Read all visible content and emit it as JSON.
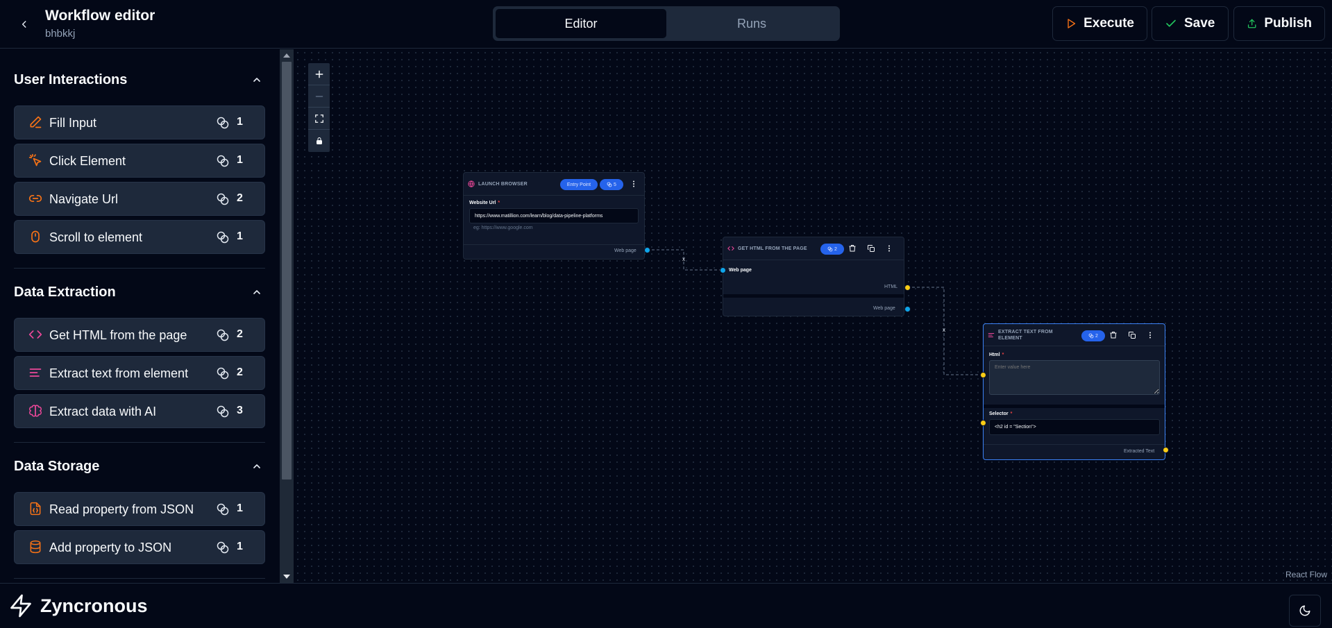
{
  "header": {
    "title": "Workflow editor",
    "subtitle": "bhbkkj",
    "tabs": [
      {
        "label": "Editor",
        "active": true
      },
      {
        "label": "Runs",
        "active": false
      }
    ],
    "buttons": {
      "execute": "Execute",
      "save": "Save",
      "publish": "Publish"
    },
    "colors": {
      "execute_icon": "#f97316",
      "save_icon": "#22c55e",
      "publish_icon": "#22c55e"
    }
  },
  "sidebar": {
    "sections": [
      {
        "title": "User Interactions",
        "items": [
          {
            "label": "Fill Input",
            "credits": "1",
            "icon": "pencil-icon"
          },
          {
            "label": "Click Element",
            "credits": "1",
            "icon": "pointer-click-icon"
          },
          {
            "label": "Navigate Url",
            "credits": "2",
            "icon": "link-icon"
          },
          {
            "label": "Scroll to element",
            "credits": "1",
            "icon": "mouse-icon"
          }
        ]
      },
      {
        "title": "Data Extraction",
        "items": [
          {
            "label": "Get HTML from the page",
            "credits": "2",
            "icon": "code-icon"
          },
          {
            "label": "Extract text from element",
            "credits": "2",
            "icon": "text-lines-icon"
          },
          {
            "label": "Extract data with AI",
            "credits": "3",
            "icon": "brain-icon"
          }
        ]
      },
      {
        "title": "Data Storage",
        "items": [
          {
            "label": "Read property from JSON",
            "credits": "1",
            "icon": "file-json-icon"
          },
          {
            "label": "Add property to JSON",
            "credits": "1",
            "icon": "database-icon"
          }
        ]
      }
    ]
  },
  "canvas": {
    "attribution": "React Flow",
    "nodes": {
      "launch": {
        "title": "LAUNCH BROWSER",
        "badge": "Entry Point",
        "credits": "5",
        "field_label": "Website Url",
        "field_value": "https://www.matillion.com/learn/blog/data-pipeline-platforms",
        "hint": "eg: https://www.google.com",
        "output": "Web page"
      },
      "gethtml": {
        "title": "GET HTML FROM THE PAGE",
        "credits": "2",
        "input": "Web page",
        "output_html": "HTML",
        "output_page": "Web page"
      },
      "extract": {
        "title": "EXTRACT TEXT FROM ELEMENT",
        "credits": "2",
        "html_label": "Html",
        "html_placeholder": "Enter value here",
        "selector_label": "Selector",
        "selector_value": "<h2 id = \"Section\">",
        "output": "Extracted Text"
      }
    },
    "edge_marker": "x"
  },
  "footer": {
    "brand": "Zyncronous"
  },
  "colors": {
    "accent_orange": "#f97316",
    "pink_icon": "#ec4899",
    "handle_blue": "#0ea5e9",
    "handle_yellow": "#facc15",
    "pill_blue": "#2563eb"
  }
}
